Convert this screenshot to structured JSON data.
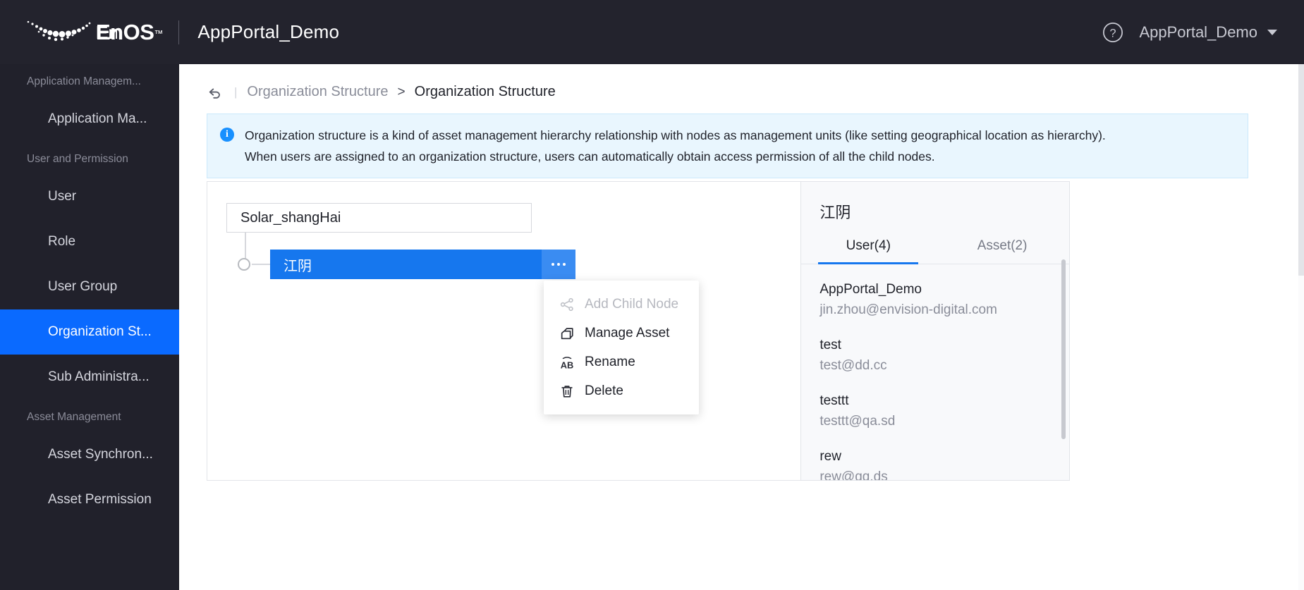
{
  "header": {
    "brand": "EnOS",
    "brand_tm": "™",
    "app_title": "AppPortal_Demo",
    "help_icon": "question-circle-icon",
    "user_name": "AppPortal_Demo",
    "caret_icon": "chevron-down-icon"
  },
  "sidebar": {
    "groups": [
      {
        "label": "Application Managem...",
        "items": [
          {
            "label": "Application Ma...",
            "active": false
          }
        ]
      },
      {
        "label": "User and Permission",
        "items": [
          {
            "label": "User",
            "active": false
          },
          {
            "label": "Role",
            "active": false
          },
          {
            "label": "User Group",
            "active": false
          },
          {
            "label": "Organization St...",
            "active": true
          },
          {
            "label": "Sub Administra...",
            "active": false
          }
        ]
      },
      {
        "label": "Asset Management",
        "items": [
          {
            "label": "Asset Synchron...",
            "active": false
          },
          {
            "label": "Asset Permission",
            "active": false
          }
        ]
      }
    ]
  },
  "breadcrumb": {
    "back_icon": "back-arrow-icon",
    "separator_bar": "|",
    "parent": "Organization Structure",
    "arrow": ">",
    "current": "Organization Structure"
  },
  "notice": {
    "icon": "info-circle-icon",
    "icon_glyph": "i",
    "line1": "Organization structure is a kind of asset management hierarchy relationship with nodes as management units (like setting geographical location as hierarchy).",
    "line2": "When users are assigned to an organization structure, users can automatically obtain access permission of all the child nodes."
  },
  "tree": {
    "root_label": "Solar_shangHai",
    "child_label": "江阴",
    "dots_button": "node-more-button"
  },
  "context_menu": {
    "items": [
      {
        "label": "Add Child Node",
        "icon": "share-nodes-icon",
        "disabled": true
      },
      {
        "label": "Manage Asset",
        "icon": "copy-stack-icon",
        "disabled": false
      },
      {
        "label": "Rename",
        "icon": "ab-rename-icon",
        "disabled": false
      },
      {
        "label": "Delete",
        "icon": "trash-icon",
        "disabled": false
      }
    ]
  },
  "detail": {
    "title": "江阴",
    "tabs": [
      {
        "label": "User(4)",
        "active": true
      },
      {
        "label": "Asset(2)",
        "active": false
      }
    ],
    "users": [
      {
        "name": "AppPortal_Demo",
        "email": "jin.zhou@envision-digital.com"
      },
      {
        "name": "test",
        "email": "test@dd.cc"
      },
      {
        "name": "testtt",
        "email": "testtt@qa.sd"
      },
      {
        "name": "rew",
        "email": "rew@qq.ds"
      }
    ]
  },
  "colors": {
    "header_bg": "#23232d",
    "sidebar_bg": "#21212b",
    "accent": "#0a6aff",
    "node_blue": "#1677ee",
    "notice_bg": "#e9f6fe"
  }
}
